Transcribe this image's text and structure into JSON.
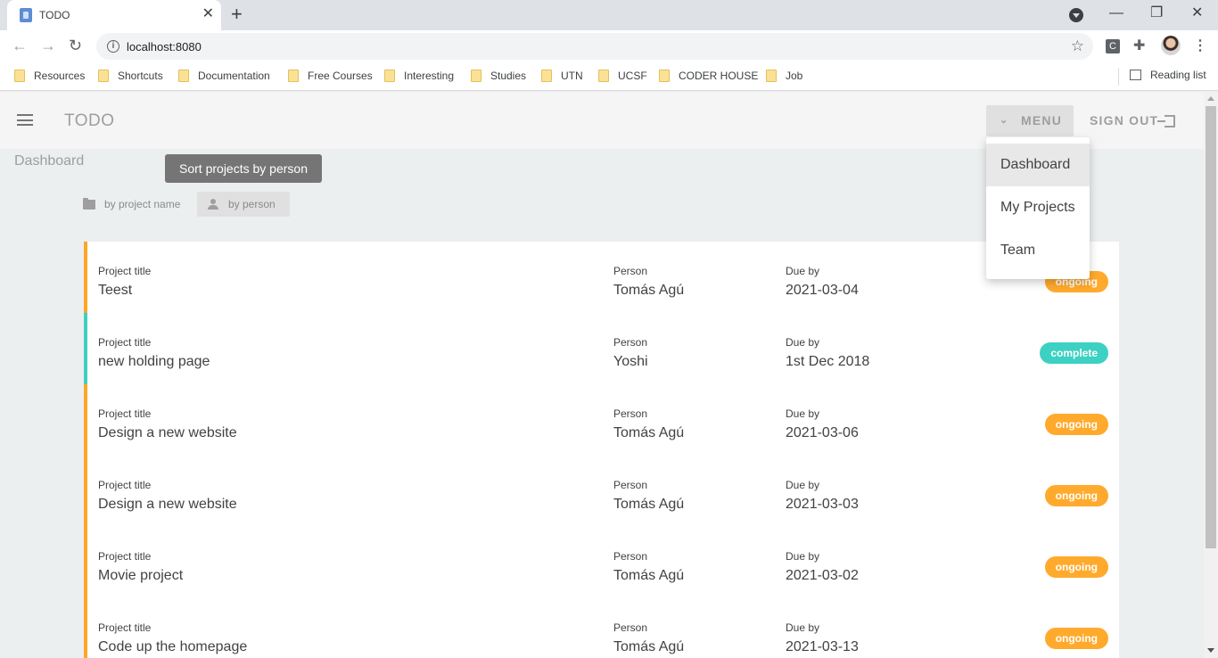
{
  "browser": {
    "tab_title": "TODO",
    "url": "localhost:8080",
    "bookmarks": [
      "Resources",
      "Shortcuts",
      "Documentation",
      "Free Courses",
      "Interesting",
      "Studies",
      "UTN",
      "UCSF",
      "CODER HOUSE",
      "Job"
    ],
    "reading_list": "Reading list",
    "ext_label": "C"
  },
  "app": {
    "title": "TODO",
    "menu_label": "MENU",
    "signout_label": "SIGN OUT",
    "page_title": "Dashboard",
    "tooltip": "Sort projects by person",
    "sort_by_name": "by project name",
    "sort_by_person": "by person",
    "col_title": "Project title",
    "col_person": "Person",
    "col_due": "Due by",
    "menu_items": [
      "Dashboard",
      "My Projects",
      "Team"
    ],
    "projects": [
      {
        "title": "Teest",
        "person": "Tomás Agú",
        "due": "2021-03-04",
        "status": "ongoing"
      },
      {
        "title": "new holding page",
        "person": "Yoshi",
        "due": "1st Dec 2018",
        "status": "complete"
      },
      {
        "title": "Design a new website",
        "person": "Tomás Agú",
        "due": "2021-03-06",
        "status": "ongoing"
      },
      {
        "title": "Design a new website",
        "person": "Tomás Agú",
        "due": "2021-03-03",
        "status": "ongoing"
      },
      {
        "title": "Movie project",
        "person": "Tomás Agú",
        "due": "2021-03-02",
        "status": "ongoing"
      },
      {
        "title": "Code up the homepage",
        "person": "Tomás Agú",
        "due": "2021-03-13",
        "status": "ongoing"
      }
    ]
  },
  "colors": {
    "ongoing": "#ffaa2c",
    "complete": "#3cd1c2"
  }
}
